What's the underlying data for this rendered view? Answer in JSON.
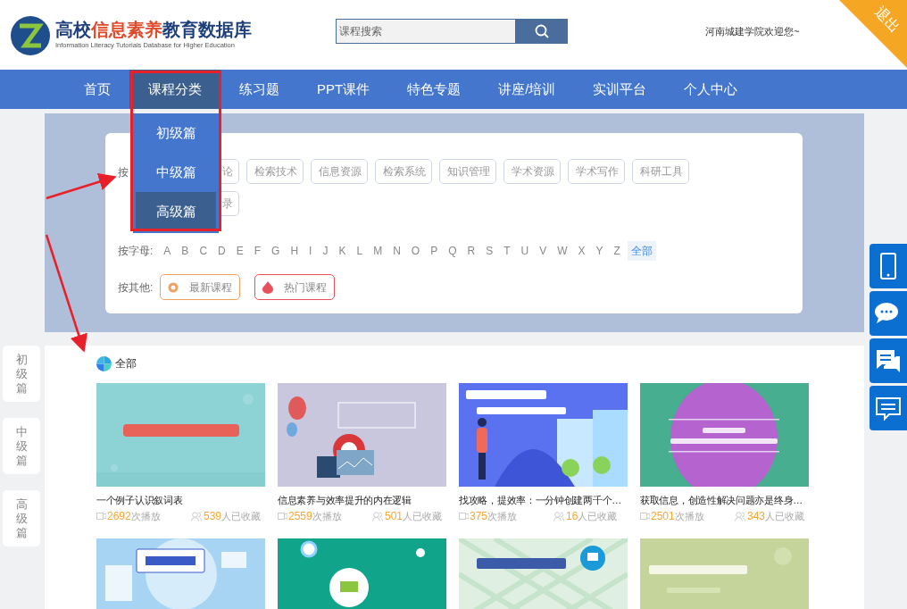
{
  "header": {
    "logo": {
      "title_start": "高校",
      "title_highlight": "信息素养",
      "title_end": "教育数据库",
      "subtitle": "Information Literacy Tutorials Database for Higher Education"
    },
    "search": {
      "placeholder": "课程搜索"
    },
    "welcome": "河南城建学院欢迎您~",
    "logout": "退出"
  },
  "nav": [
    {
      "label": "首页",
      "selected": false
    },
    {
      "label": "课程分类",
      "selected": true
    },
    {
      "label": "练习题",
      "selected": false
    },
    {
      "label": "PPT课件",
      "selected": false
    },
    {
      "label": "特色专题",
      "selected": false
    },
    {
      "label": "讲座/培训",
      "selected": false
    },
    {
      "label": "实训平台",
      "selected": false
    },
    {
      "label": "个人中心",
      "selected": false
    }
  ],
  "dropdown": [
    {
      "label": "初级篇",
      "selected": false
    },
    {
      "label": "中级篇",
      "selected": false
    },
    {
      "label": "高级篇",
      "selected": true
    }
  ],
  "filters": {
    "category_label": "按",
    "categories": [
      [
        "论",
        "检索技术",
        "信息资源",
        "检索系统",
        "知识管理",
        "学术资源",
        "学术写作",
        "科研工具"
      ],
      [
        "录"
      ]
    ],
    "letter_label": "按字母:",
    "letters": [
      {
        "label": "A",
        "selected": false
      },
      {
        "label": "B",
        "selected": false
      },
      {
        "label": "C",
        "selected": false
      },
      {
        "label": "D",
        "selected": false
      },
      {
        "label": "E",
        "selected": false
      },
      {
        "label": "F",
        "selected": false
      },
      {
        "label": "G",
        "selected": false
      },
      {
        "label": "H",
        "selected": false
      },
      {
        "label": "I",
        "selected": false
      },
      {
        "label": "J",
        "selected": false
      },
      {
        "label": "K",
        "selected": false
      },
      {
        "label": "L",
        "selected": false
      },
      {
        "label": "M",
        "selected": false
      },
      {
        "label": "N",
        "selected": false
      },
      {
        "label": "O",
        "selected": false
      },
      {
        "label": "P",
        "selected": false
      },
      {
        "label": "Q",
        "selected": false
      },
      {
        "label": "R",
        "selected": false
      },
      {
        "label": "S",
        "selected": false
      },
      {
        "label": "T",
        "selected": false
      },
      {
        "label": "U",
        "selected": false
      },
      {
        "label": "V",
        "selected": false
      },
      {
        "label": "W",
        "selected": false
      },
      {
        "label": "X",
        "selected": false
      },
      {
        "label": "Y",
        "selected": false
      },
      {
        "label": "Z",
        "selected": false
      },
      {
        "label": "全部",
        "selected": true
      }
    ],
    "other_label": "按其他:",
    "others": [
      {
        "label": "最新课程",
        "kind": "new",
        "color": "#f0a060"
      },
      {
        "label": "热门课程",
        "kind": "hot",
        "color": "#e8505b"
      }
    ]
  },
  "side_tabs": [
    "初级篇",
    "中级篇",
    "高级篇"
  ],
  "section_title": "全部",
  "courses": [
    {
      "kind": "course",
      "title": "一个例子认识叙词表",
      "plays": "2692",
      "plays_unit": "次播放",
      "favorites": "539",
      "favorites_unit": "人已收藏"
    },
    {
      "kind": "course",
      "title": "信息素养与效率提升的内在逻辑",
      "plays": "2559",
      "plays_unit": "次播放",
      "favorites": "501",
      "favorites_unit": "人已收藏"
    },
    {
      "kind": "course",
      "title": "找攻略，提效率：一分钟创建两千个…",
      "plays": "375",
      "plays_unit": "次播放",
      "favorites": "16",
      "favorites_unit": "人已收藏"
    },
    {
      "kind": "course",
      "title": "获取信息，创造性解决问题亦是终身…",
      "plays": "2501",
      "plays_unit": "次播放",
      "favorites": "343",
      "favorites_unit": "人已收藏"
    },
    {
      "kind": "picture"
    },
    {
      "kind": "picture"
    },
    {
      "kind": "picture"
    },
    {
      "kind": "picture"
    }
  ]
}
